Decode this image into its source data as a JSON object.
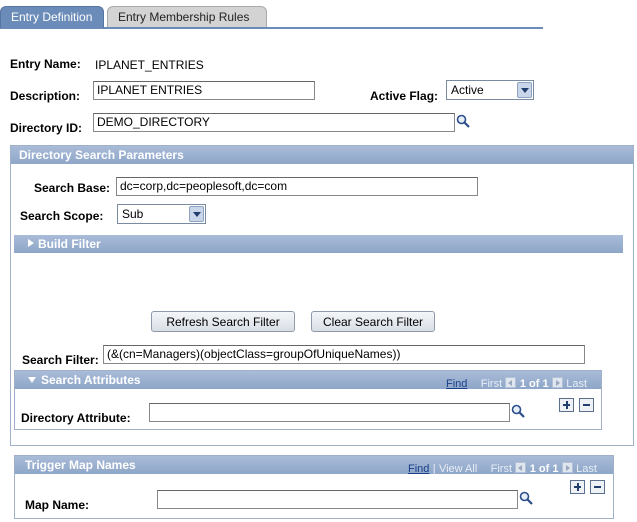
{
  "tabs": [
    {
      "label": "Entry Definition",
      "active": true
    },
    {
      "label": "Entry Membership Rules",
      "active": false
    }
  ],
  "entry": {
    "name_label": "Entry Name:",
    "name_value": "IPLANET_ENTRIES",
    "description_label": "Description:",
    "description_value": "IPLANET ENTRIES",
    "active_flag_label": "Active Flag:",
    "active_flag_value": "Active",
    "directory_id_label": "Directory ID:",
    "directory_id_value": "DEMO_DIRECTORY"
  },
  "search_params": {
    "header": "Directory Search Parameters",
    "base_label": "Search Base:",
    "base_value": "dc=corp,dc=peoplesoft,dc=com",
    "scope_label": "Search Scope:",
    "scope_value": "Sub",
    "build_filter_header": "Build Filter",
    "refresh_button": "Refresh Search Filter",
    "clear_button": "Clear Search Filter",
    "filter_label": "Search Filter:",
    "filter_value": "(&(cn=Managers)(objectClass=groupOfUniqueNames))"
  },
  "search_attributes": {
    "header": "Search Attributes",
    "find": "Find",
    "first": "First",
    "count": "1 of 1",
    "last": "Last",
    "attribute_label": "Directory Attribute:",
    "attribute_value": ""
  },
  "trigger_map": {
    "header": "Trigger Map Names",
    "find": "Find",
    "separator": "|",
    "view_all": "View All",
    "first": "First",
    "count": "1 of 1",
    "last": "Last",
    "map_label": "Map Name:",
    "map_value": ""
  },
  "colors": {
    "tab_active": "#6b8bb8",
    "section_header": "#8ea6c8",
    "link": "#1a3f8a"
  }
}
